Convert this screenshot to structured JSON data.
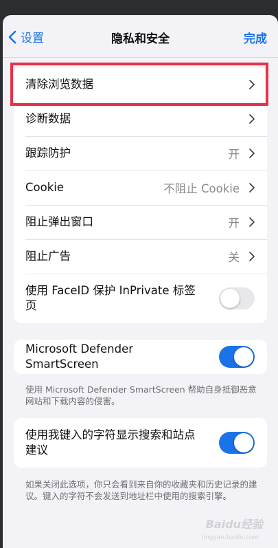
{
  "nav": {
    "back_label": "设置",
    "title": "隐私和安全",
    "done_label": "完成"
  },
  "group1": [
    {
      "label": "清除浏览数据",
      "value": ""
    },
    {
      "label": "诊断数据",
      "value": ""
    },
    {
      "label": "跟踪防护",
      "value": "开"
    },
    {
      "label": "Cookie",
      "value": "不阻止 Cookie"
    },
    {
      "label": "阻止弹出窗口",
      "value": "开"
    },
    {
      "label": "阻止广告",
      "value": "关"
    }
  ],
  "faceid": {
    "label": "使用 FaceID 保护 InPrivate 标签页",
    "enabled": false
  },
  "smartscreen": {
    "label": "Microsoft Defender SmartScreen",
    "enabled": true,
    "footnote": "使用 Microsoft Defender SmartScreen 帮助自身抵御恶意网站和下载内容的侵害。"
  },
  "suggestions": {
    "label": "使用我键入的字符显示搜索和站点建议",
    "enabled": true,
    "footnote": "如果关闭此选项，你只会看到来自你的收藏夹和历史记录的建议。键入的字符不会发送到地址栏中使用的搜索引擎。"
  },
  "watermark": {
    "text": "Baidu经验",
    "sub": "jingyan.baidu.com"
  },
  "colors": {
    "accent": "#1a73e8",
    "highlight": "#e8304a"
  }
}
